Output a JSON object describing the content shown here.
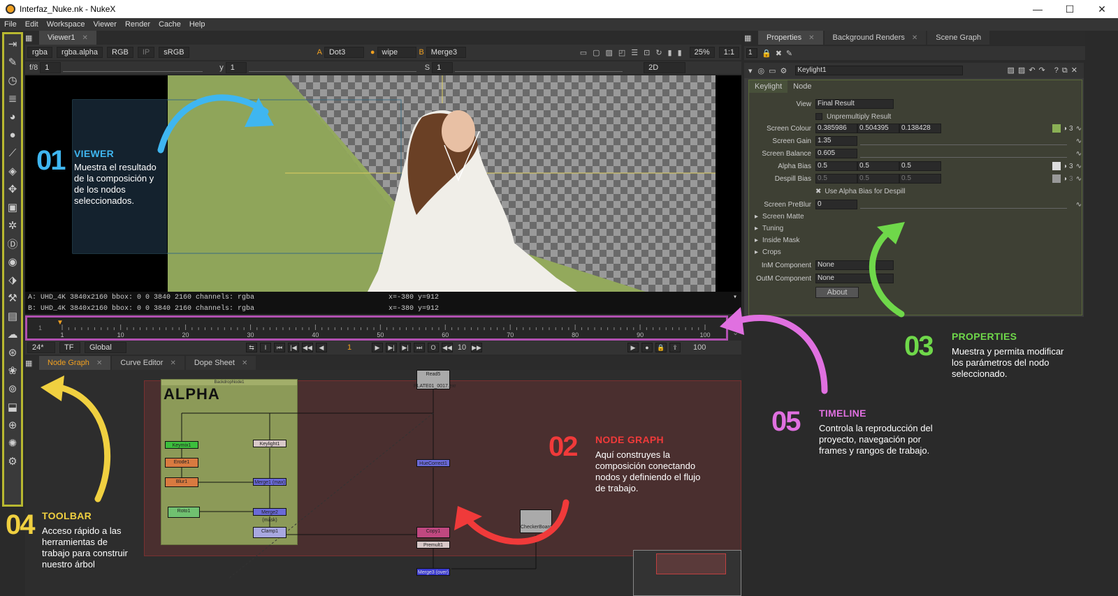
{
  "window": {
    "title": "Interfaz_Nuke.nk - NukeX",
    "minimize": "—",
    "maximize": "☐",
    "close": "✕"
  },
  "menu": [
    "File",
    "Edit",
    "Workspace",
    "Viewer",
    "Render",
    "Cache",
    "Help"
  ],
  "viewer": {
    "tab": "Viewer1",
    "channels": "rgba",
    "alpha": "rgba.alpha",
    "colorspace": "RGB",
    "ip": "IP",
    "lut": "sRGB",
    "a_label": "A",
    "a_input": "Dot3",
    "wipe": "wipe",
    "b_label": "B",
    "b_input": "Merge3",
    "zoom": "25%",
    "ratio": "1:1",
    "fstop": "f/8",
    "gain": "1",
    "y_label": "y",
    "y_value": "1",
    "s_label": "S",
    "s_value": "1",
    "mode": "2D",
    "info_a": "A:  UHD_4K 3840x2160  bbox: 0 0 3840 2160 channels: rgba",
    "info_b": "B:  UHD_4K 3840x2160  bbox: 0 0 3840 2160 channels: rgba",
    "coords_a": "x=-380 y=912",
    "coords_b": "x=-380 y=912"
  },
  "timeline": {
    "start": "1",
    "ticks": [
      "1",
      "10",
      "20",
      "30",
      "40",
      "50",
      "60",
      "70",
      "80",
      "90",
      "100"
    ],
    "fps": "24*",
    "tf": "TF",
    "range": "Global",
    "current_frame": "1",
    "step": "10",
    "end": "100"
  },
  "bottom_tabs": [
    "Node Graph",
    "Curve Editor",
    "Dope Sheet"
  ],
  "nodegraph": {
    "backdrop": "BackdropNode1",
    "backdrop_title": "ALPHA",
    "nodes": {
      "read": "Read5",
      "read_file": "PLATE01_0017.exr",
      "keymix": "Keymix1",
      "keylight": "Keylight1",
      "erode": "Erode1",
      "erode_sub": "(alpha)",
      "blur": "Blur1",
      "blur_sub": "(all)",
      "roto": "Roto1",
      "roto_sub": "(alpha)",
      "merge1": "Merge1 (max)",
      "merge2": "Merge2 (mask)",
      "clamp": "Clamp1",
      "clamp_sub": "(all)",
      "huecorrect": "HueCorrect1",
      "copy": "Copy1",
      "premult": "Premult1",
      "checker": "CheckerBoard",
      "merge3": "Merge3 (over)"
    }
  },
  "properties": {
    "tabs": [
      "Properties",
      "Background Renders",
      "Scene Graph"
    ],
    "count": "1",
    "node_name": "Keylight1",
    "node_tabs": [
      "Keylight",
      "Node"
    ],
    "view_label": "View",
    "view_value": "Final Result",
    "unpremult": "Unpremultiply Result",
    "screen_colour_label": "Screen Colour",
    "screen_colour": [
      "0.385986",
      "0.504395",
      "0.138428"
    ],
    "screen_gain_label": "Screen Gain",
    "screen_gain": "1.35",
    "screen_balance_label": "Screen Balance",
    "screen_balance": "0.605",
    "alpha_bias_label": "Alpha Bias",
    "alpha_bias": [
      "0.5",
      "0.5",
      "0.5"
    ],
    "despill_bias_label": "Despill Bias",
    "despill_bias": [
      "0.5",
      "0.5",
      "0.5"
    ],
    "use_alpha_bias": "Use Alpha Bias for Despill",
    "preblur_label": "Screen PreBlur",
    "preblur": "0",
    "groups": [
      "Screen Matte",
      "Tuning",
      "Inside Mask",
      "Crops"
    ],
    "inm_label": "InM Component",
    "inm_value": "None",
    "outm_label": "OutM Component",
    "outm_value": "None",
    "about": "About",
    "channel_count": "3",
    "slider_ticks_gain": [
      "0",
      "0.2",
      "0.4",
      "0.6",
      "0.8",
      "1",
      "1.2",
      "1.4",
      "1.6",
      "1.8"
    ],
    "slider_ticks_preblur": [
      "0",
      "10",
      "20",
      "30",
      "40",
      "50",
      "57.344"
    ]
  },
  "annotations": {
    "viewer": {
      "num": "01",
      "title": "VIEWER",
      "body": [
        "Muestra el resultado",
        "de la composición y",
        "de los nodos",
        "seleccionados."
      ],
      "color": "#3fb6f0"
    },
    "nodegraph": {
      "num": "02",
      "title": "NODE GRAPH",
      "body": [
        "Aquí construyes la",
        "composición conectando",
        "nodos y definiendo el flujo",
        "de trabajo."
      ],
      "color": "#f03a3a"
    },
    "properties": {
      "num": "03",
      "title": "PROPERTIES",
      "body": [
        "Muestra y permita modificar",
        "los parámetros del nodo",
        "seleccionado."
      ],
      "color": "#6fd84a"
    },
    "toolbar": {
      "num": "04",
      "title": "TOOLBAR",
      "body": [
        "Acceso rápido a las",
        "herramientas de",
        "trabajo para construir",
        "nuestro árbol"
      ],
      "color": "#f0d040"
    },
    "timeline": {
      "num": "05",
      "title": "TIMELINE",
      "body": [
        "Controla la reproducción del",
        "proyecto, navegación por",
        "frames y rangos de trabajo."
      ],
      "color": "#e070e0"
    }
  }
}
